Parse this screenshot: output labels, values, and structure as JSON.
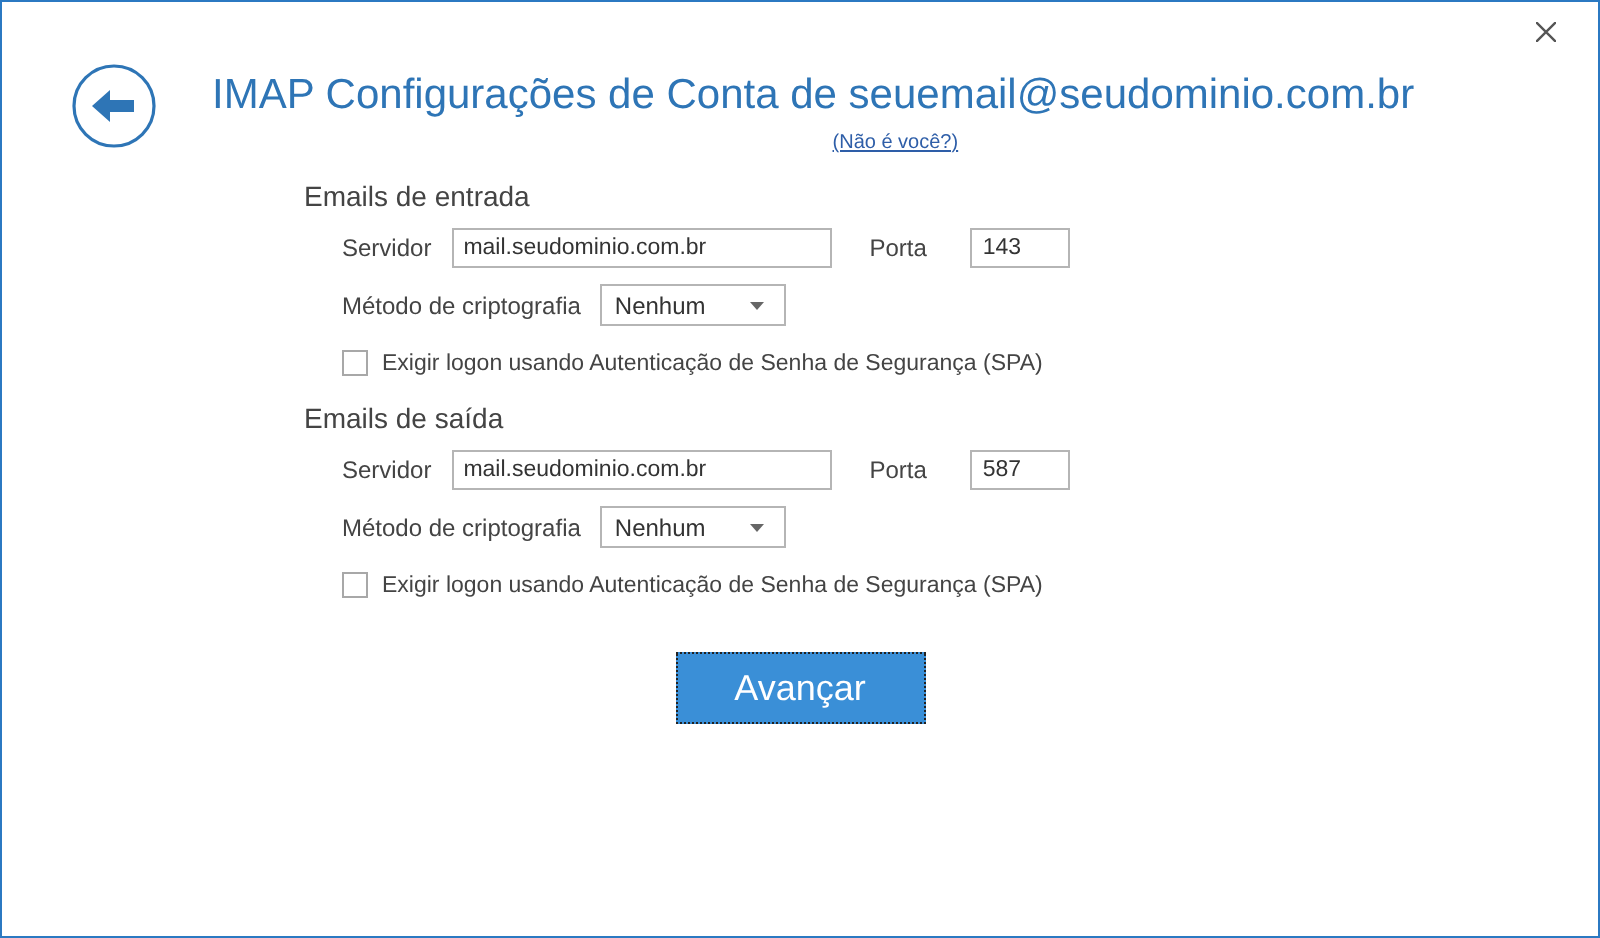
{
  "title": "IMAP Configurações de Conta de seuemail@seudominio.com.br",
  "not_you_link": "(Não é você?)",
  "sections": [
    {
      "heading": "Emails de entrada",
      "server_label": "Servidor",
      "server": "mail.seudominio.com.br",
      "port_label": "Porta",
      "port": "143",
      "encryption_label": "Método de criptografia",
      "encryption": "Nenhum",
      "spa": {
        "label": "Exigir logon usando Autenticação de Senha de Segurança (SPA)",
        "checked": false
      }
    },
    {
      "heading": "Emails de saída",
      "server_label": "Servidor",
      "server": "mail.seudominio.com.br",
      "port_label": "Porta",
      "port": "587",
      "encryption_label": "Método de criptografia",
      "encryption": "Nenhum",
      "spa": {
        "label": "Exigir logon usando Autenticação de Senha de Segurança (SPA)",
        "checked": false
      }
    }
  ],
  "next_button": "Avançar"
}
